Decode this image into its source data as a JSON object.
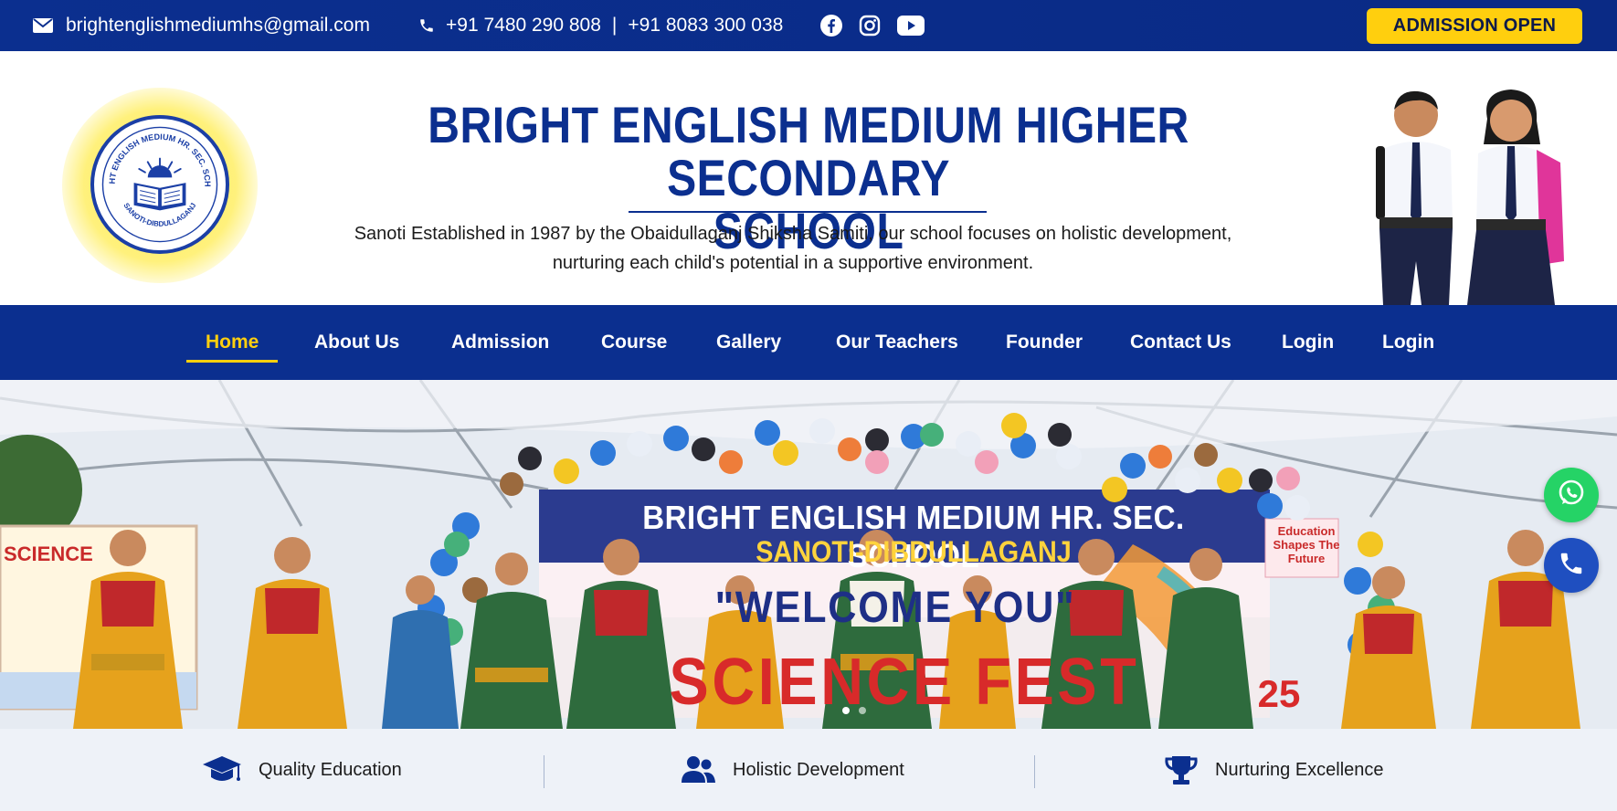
{
  "topbar": {
    "email": "brightenglishmediumhs@gmail.com",
    "phone1": "+91 7480 290 808",
    "phone_separator": "|",
    "phone2": "+91 8083 300 038",
    "social_icons": [
      "facebook-icon",
      "instagram-icon",
      "youtube-icon"
    ],
    "admission_label": "ADMISSION OPEN"
  },
  "header": {
    "title_line1": "BRIGHT ENGLISH MEDIUM HIGHER SECONDARY",
    "title_line2": "SCHOOL",
    "tagline_line1": "Sanoti Established in 1987 by the Obaidullaganj Shiksha Samiti, our school focuses on holistic development,",
    "tagline_line2": "nurturing each child's potential in a supportive environment.",
    "logo_text_top": "BRIGHT ENGLISH MEDIUM HR. SEC. SCHOOL",
    "logo_text_bottom": "SANOTI-DIBDULLAGANJ"
  },
  "nav": {
    "items": [
      {
        "label": "Home",
        "active": true
      },
      {
        "label": "About Us"
      },
      {
        "label": "Admission"
      },
      {
        "label": "Course"
      },
      {
        "label": "Gallery"
      },
      {
        "label": "Our Teachers"
      },
      {
        "label": "Founder"
      },
      {
        "label": "Contact Us"
      },
      {
        "label": "Login"
      },
      {
        "label": "Login"
      }
    ]
  },
  "hero": {
    "banner_title": "BRIGHT ENGLISH MEDIUM HR. SEC. SCHOOL",
    "banner_subtitle": "SANOTI-DIBDULLAGANJ",
    "banner_welcome": "\"WELCOME YOU\"",
    "banner_fest": "SCIENCE FEST",
    "banner_year": "25",
    "edu_sign": "Education Shapes The Future",
    "science_sign": "SCIENCE",
    "slide_count": 2,
    "active_slide": 1
  },
  "floating": {
    "whatsapp_icon": "whatsapp-icon",
    "call_icon": "phone-icon"
  },
  "features": [
    {
      "label": "Quality Education",
      "icon": "graduation-cap-icon"
    },
    {
      "label": "Holistic Development",
      "icon": "users-icon"
    },
    {
      "label": "Nurturing Excellence",
      "icon": "trophy-icon"
    }
  ],
  "colors": {
    "brand_blue": "#0b2f8f",
    "accent_yellow": "#ffcf0e",
    "feature_bg": "#eef2f8",
    "whatsapp_green": "#25d366"
  }
}
